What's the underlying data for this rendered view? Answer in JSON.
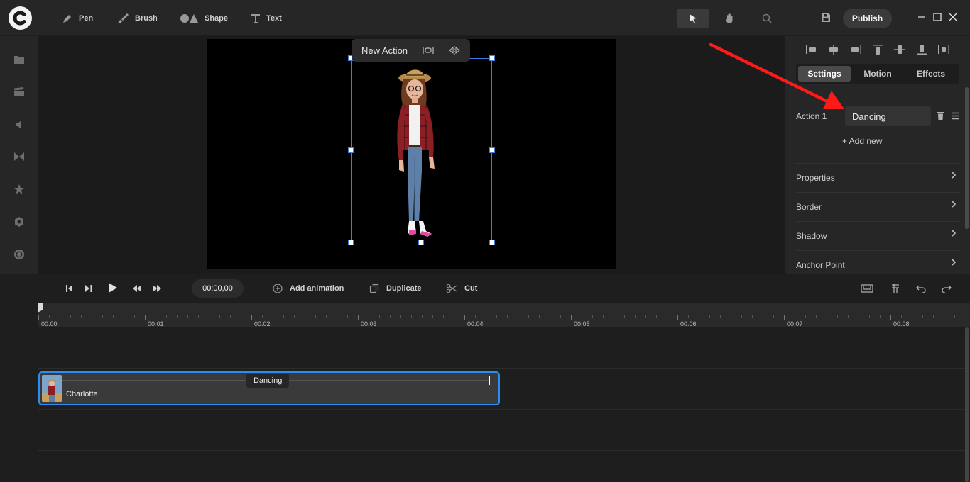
{
  "toolbar": {
    "tools": [
      {
        "label": "Pen",
        "icon": "pen-icon"
      },
      {
        "label": "Brush",
        "icon": "brush-icon"
      },
      {
        "label": "Shape",
        "icon": "shape-icon"
      },
      {
        "label": "Text",
        "icon": "text-icon"
      }
    ],
    "publish_label": "Publish"
  },
  "sidebar": {
    "items": [
      {
        "icon": "folder-icon"
      },
      {
        "icon": "clapper-icon"
      },
      {
        "icon": "speaker-icon"
      },
      {
        "icon": "transition-icon"
      },
      {
        "icon": "star-icon"
      },
      {
        "icon": "hexagon-icon"
      },
      {
        "icon": "record-icon"
      }
    ]
  },
  "canvas": {
    "popup_label": "New Action"
  },
  "panel": {
    "tabs": [
      "Settings",
      "Motion",
      "Effects"
    ],
    "active_tab": "Settings",
    "action_label": "Action 1",
    "action_value": "Dancing",
    "add_new": "+ Add new",
    "sections": [
      "Properties",
      "Border",
      "Shadow",
      "Anchor Point"
    ]
  },
  "timeline": {
    "time": "00:00,00",
    "add_animation": "Add animation",
    "duplicate": "Duplicate",
    "cut": "Cut",
    "ruler": [
      "00:00",
      "00:01",
      "00:02",
      "00:03",
      "00:04",
      "00:05",
      "00:06",
      "00:07",
      "00:08"
    ],
    "clip_name": "Charlotte",
    "clip_action": "Dancing"
  },
  "colors": {
    "accent": "#2a8df0",
    "selection": "#3f7de0",
    "annotation_arrow": "#ff1a1a"
  }
}
